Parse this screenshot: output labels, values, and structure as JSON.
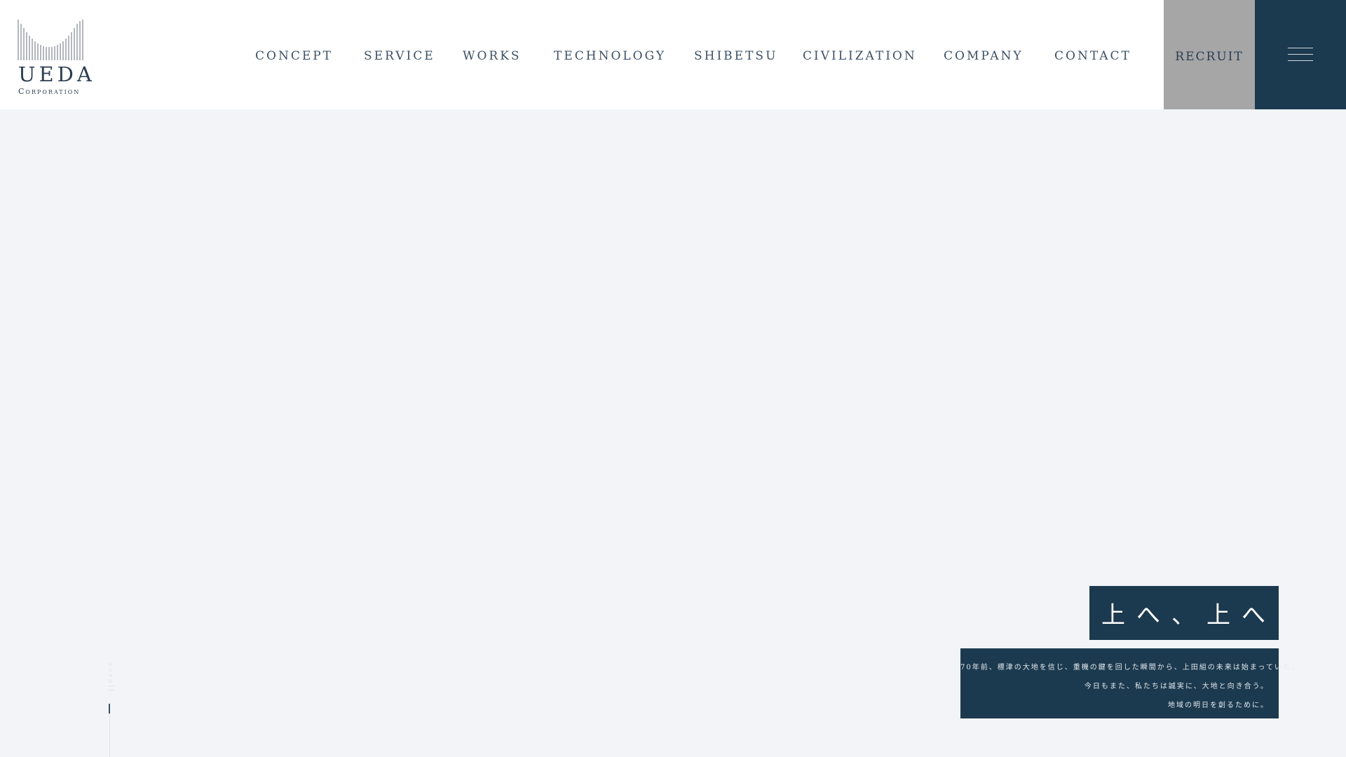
{
  "brand": {
    "name": "UEDA",
    "sub": "Corporation"
  },
  "nav": {
    "items": [
      {
        "label": "CONCEPT"
      },
      {
        "label": "SERVICE"
      },
      {
        "label": "WORKS"
      },
      {
        "label": "TECHNOLOGY"
      },
      {
        "label": "SHIBETSU"
      },
      {
        "label": "CIVILIZATION"
      },
      {
        "label": "COMPANY"
      },
      {
        "label": "CONTACT"
      }
    ],
    "recruit_label": "RECRUIT"
  },
  "hero": {
    "catch": "上へ、上へ",
    "lead": [
      "70年前、標津の大地を信じ、重機の鍵を回した瞬間から、上田組の未来は始まっていた。",
      "今日もまた、私たちは誠実に、大地と向き合う。",
      "地域の明日を創るために。"
    ],
    "scroll_label": "scroll"
  },
  "colors": {
    "accent": "#1c3a4f",
    "recruit_bg": "#a6a6a6",
    "text": "#3b5066",
    "background": "#f2f4f8"
  },
  "icons": {
    "menu": "hamburger-menu-icon",
    "logo": "ueda-bars-logo-icon"
  }
}
